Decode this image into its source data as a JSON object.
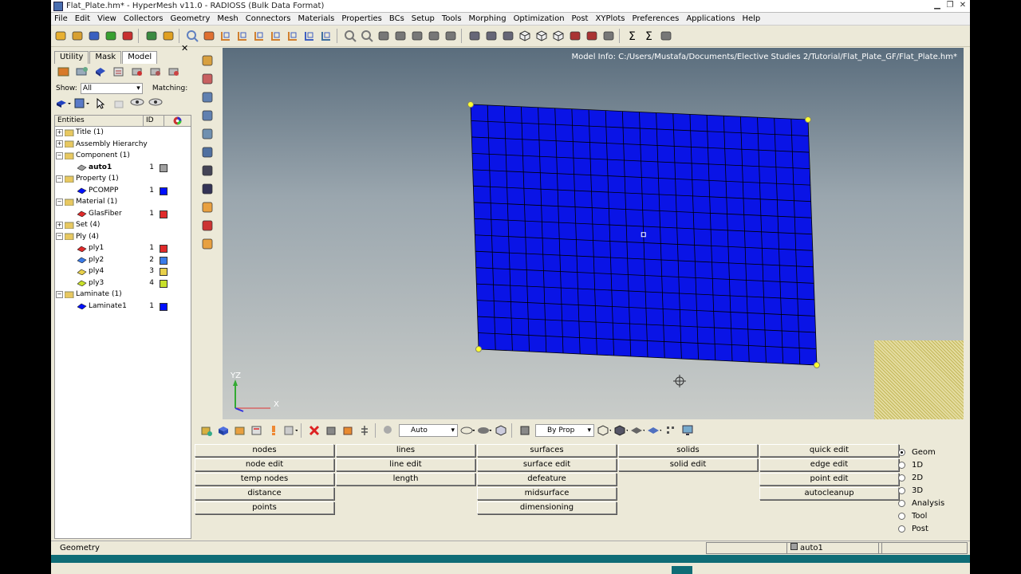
{
  "window": {
    "title": "Flat_Plate.hm* - HyperMesh v11.0 - RADIOSS (Bulk Data Format)"
  },
  "menu": [
    "File",
    "Edit",
    "View",
    "Collectors",
    "Geometry",
    "Mesh",
    "Connectors",
    "Materials",
    "Properties",
    "BCs",
    "Setup",
    "Tools",
    "Morphing",
    "Optimization",
    "Post",
    "XYPlots",
    "Preferences",
    "Applications",
    "Help"
  ],
  "browser": {
    "tabs": [
      "Utility",
      "Mask",
      "Model"
    ],
    "active_tab": "Model",
    "show_label": "Show:",
    "show_value": "All",
    "matching_label": "Matching:",
    "headers": {
      "entities": "Entities",
      "id": "ID"
    },
    "rows": [
      {
        "label": "Title (1)",
        "level": 0,
        "expand": "+",
        "icon": "folder-icon"
      },
      {
        "label": "Assembly Hierarchy",
        "level": 0,
        "expand": "+",
        "icon": "assembly-icon"
      },
      {
        "label": "Component (1)",
        "level": 0,
        "expand": "−",
        "icon": "component-folder-icon"
      },
      {
        "label": "auto1",
        "level": 1,
        "id": "1",
        "color": "#a0a0a0",
        "bold": true,
        "icon": "component-icon"
      },
      {
        "label": "Property (1)",
        "level": 0,
        "expand": "−",
        "icon": "property-folder-icon"
      },
      {
        "label": "PCOMPP",
        "level": 1,
        "id": "1",
        "color": "#0010ff",
        "icon": "property-icon"
      },
      {
        "label": "Material (1)",
        "level": 0,
        "expand": "−",
        "icon": "material-folder-icon"
      },
      {
        "label": "GlasFiber",
        "level": 1,
        "id": "1",
        "color": "#e02a2a",
        "icon": "material-icon"
      },
      {
        "label": "Set (4)",
        "level": 0,
        "expand": "+",
        "icon": "set-folder-icon"
      },
      {
        "label": "Ply (4)",
        "level": 0,
        "expand": "−",
        "icon": "ply-folder-icon"
      },
      {
        "label": "ply1",
        "level": 1,
        "id": "1",
        "color": "#e02a2a",
        "icon": "ply-icon"
      },
      {
        "label": "ply2",
        "level": 1,
        "id": "2",
        "color": "#3a7be8",
        "icon": "ply-icon"
      },
      {
        "label": "ply4",
        "level": 1,
        "id": "3",
        "color": "#e8d04a",
        "icon": "ply-icon"
      },
      {
        "label": "ply3",
        "level": 1,
        "id": "4",
        "color": "#c8e02a",
        "icon": "ply-icon"
      },
      {
        "label": "Laminate (1)",
        "level": 0,
        "expand": "−",
        "icon": "laminate-folder-icon"
      },
      {
        "label": "Laminate1",
        "level": 1,
        "id": "1",
        "color": "#0010ff",
        "icon": "laminate-icon"
      }
    ]
  },
  "viewport": {
    "model_info": "Model Info: C:/Users/Mustafa/Documents/Elective Studies 2/Tutorial/Flat_Plate_GF/Flat_Plate.hm*",
    "axis_label": "YZ",
    "axis_x_label": "X",
    "mesh_color": "#0a14e6",
    "mesh_line_color": "#000000",
    "node_color": "#ffff30"
  },
  "bottom_toolbar": {
    "select_1": "Auto",
    "select_2": "By Prop"
  },
  "panel": {
    "columns": [
      [
        "nodes",
        "node edit",
        "temp nodes",
        "distance",
        "points"
      ],
      [
        "lines",
        "line edit",
        "length",
        "",
        ""
      ],
      [
        "surfaces",
        "surface edit",
        "defeature",
        "midsurface",
        "dimensioning"
      ],
      [
        "solids",
        "solid edit",
        "",
        "",
        ""
      ],
      [
        "quick edit",
        "edge edit",
        "point edit",
        "autocleanup",
        ""
      ]
    ],
    "radios": [
      {
        "label": "Geom",
        "checked": true
      },
      {
        "label": "1D",
        "checked": false
      },
      {
        "label": "2D",
        "checked": false
      },
      {
        "label": "3D",
        "checked": false
      },
      {
        "label": "Analysis",
        "checked": false
      },
      {
        "label": "Tool",
        "checked": false
      },
      {
        "label": "Post",
        "checked": false
      }
    ]
  },
  "status": {
    "left": "Geometry",
    "component": "auto1"
  }
}
